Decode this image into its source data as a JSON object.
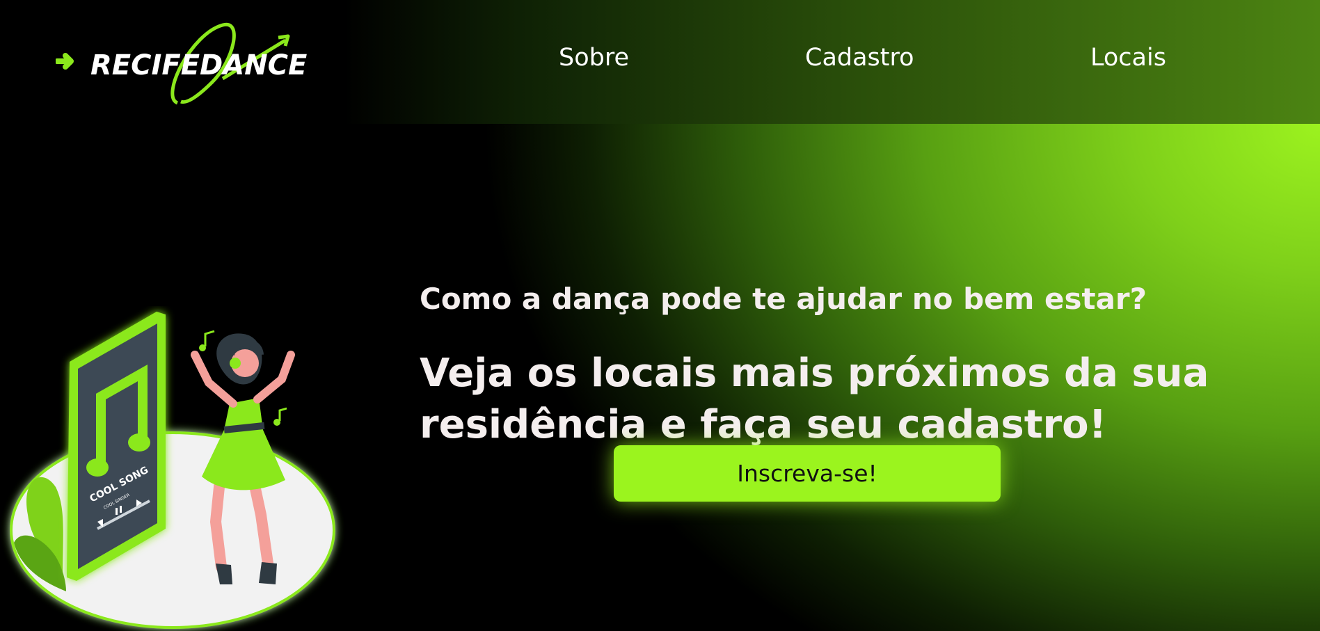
{
  "header": {
    "logo_text": "RECIFEDANCE",
    "nav": [
      {
        "label": "Sobre"
      },
      {
        "label": "Cadastro"
      },
      {
        "label": "Locais"
      }
    ]
  },
  "hero": {
    "question": "Como a dança pode te ajudar no bem estar?",
    "headline": "Veja os locais mais próximos da sua residência e faça seu cadastro!",
    "cta_label": "Inscreva-se!"
  },
  "illustration": {
    "phone_song_title": "COOL SONG",
    "phone_song_artist": "COOL SINGER"
  },
  "colors": {
    "accent": "#9bf41e",
    "background": "#000000",
    "text": "#f4eeee"
  }
}
